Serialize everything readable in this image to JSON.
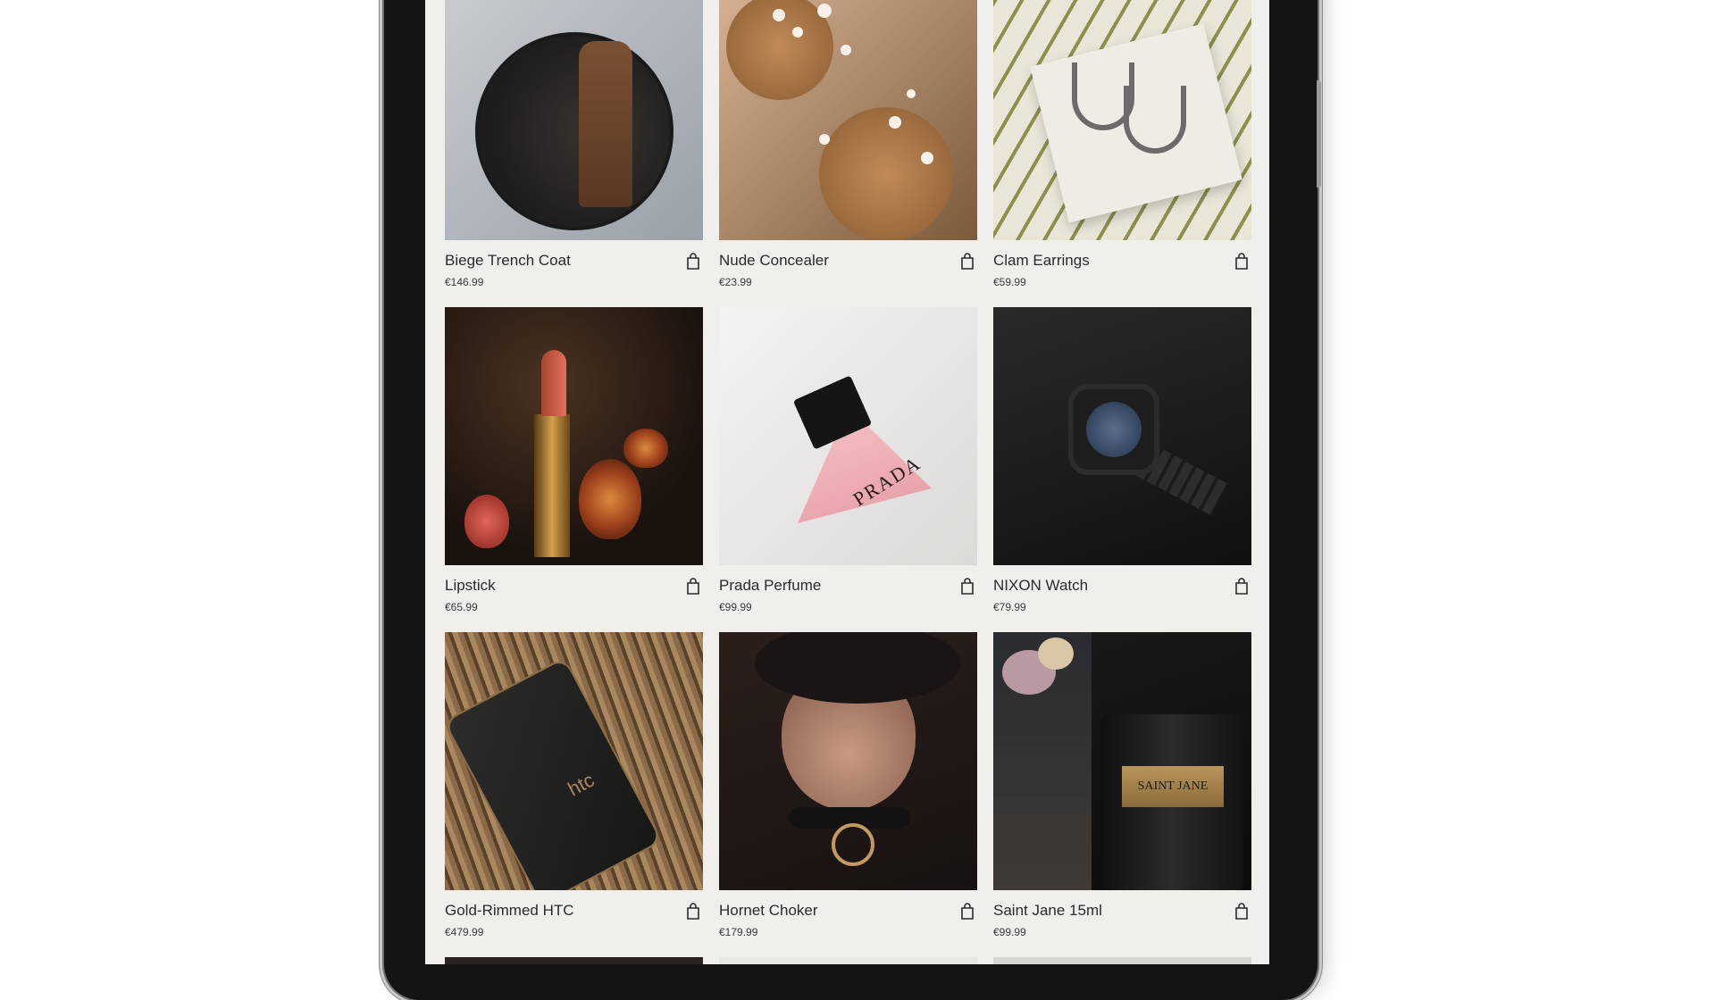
{
  "products": [
    {
      "name": "Biege Trench Coat",
      "price": "€146.99",
      "icon": "shopping-bag-icon"
    },
    {
      "name": "Nude Concealer",
      "price": "€23.99",
      "icon": "shopping-bag-icon"
    },
    {
      "name": "Clam Earrings",
      "price": "€59.99",
      "icon": "shopping-bag-icon"
    },
    {
      "name": "Lipstick",
      "price": "€65.99",
      "icon": "shopping-bag-icon"
    },
    {
      "name": "Prada Perfume",
      "price": "€99.99",
      "icon": "shopping-bag-icon"
    },
    {
      "name": "NIXON Watch",
      "price": "€79.99",
      "icon": "shopping-bag-icon"
    },
    {
      "name": "Gold-Rimmed HTC",
      "price": "€479.99",
      "icon": "shopping-bag-icon"
    },
    {
      "name": "Hornet Choker",
      "price": "€179.99",
      "icon": "shopping-bag-icon"
    },
    {
      "name": "Saint Jane 15ml",
      "price": "€99.99",
      "icon": "shopping-bag-icon"
    }
  ],
  "image_text": {
    "perfume_brand": "PRADA",
    "phone_brand": "htc",
    "jar_label": "SAINT JANE"
  },
  "colors": {
    "screen_background": "#f1efeb",
    "device_frame": "#141414",
    "text": "#2b2b2b"
  }
}
